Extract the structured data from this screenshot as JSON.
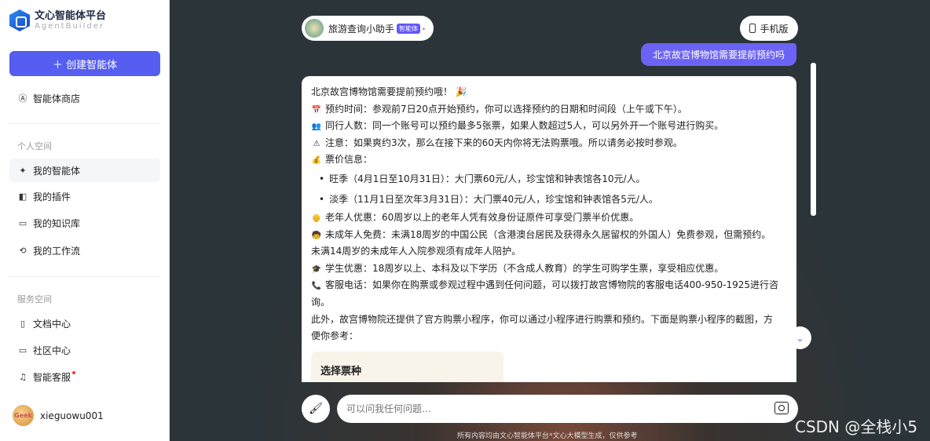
{
  "sidebar": {
    "logo_title": "文心智能体平台",
    "logo_sub": "AgentBuilder",
    "create_label": "创建智能体",
    "store": "智能体商店",
    "personal_title": "个人空间",
    "personal": [
      "我的智能体",
      "我的插件",
      "我的知识库",
      "我的工作流"
    ],
    "service_title": "服务空间",
    "service": [
      "文档中心",
      "社区中心",
      "智能客服"
    ],
    "username": "xieguowu001",
    "avatar_text": "Geek"
  },
  "header": {
    "agent_name": "旅游查询小助手",
    "agent_badge": "智能体",
    "mobile_label": "手机版"
  },
  "chat": {
    "user_message": "北京故宫博物馆需要提前预约吗",
    "answer": {
      "intro": "北京故宫博物馆需要提前预约哦！",
      "lines1": [
        {
          "icon": "calendar",
          "text": "预约时间：参观前7日20点开始预约，你可以选择预约的日期和时间段（上午或下午）。"
        },
        {
          "icon": "people",
          "text": "同行人数：同一个账号可以预约最多5张票，如果人数超过5人，可以另外开一个账号进行购买。"
        },
        {
          "icon": "warning",
          "text": "注意：如果爽约3次，那么在接下来的60天内你将无法购票哦。所以请务必按时参观。"
        },
        {
          "icon": "money-bag",
          "text": "票价信息："
        }
      ],
      "bullets": [
        "旺季（4月1日至10月31日）：大门票60元/人，珍宝馆和钟表馆各10元/人。",
        "淡季（11月1日至次年3月31日）：大门票40元/人，珍宝馆和钟表馆各5元/人。"
      ],
      "lines2": [
        {
          "icon": "elder",
          "text": "老年人优惠：60周岁以上的老年人凭有效身份证原件可享受门票半价优惠。"
        },
        {
          "icon": "child",
          "text": "未成年人免费：未满18周岁的中国公民（含港澳台居民及获得永久居留权的外国人）免费参观，但需预约。"
        },
        {
          "icon": "",
          "text": "未满14周岁的未成年人入院参观须有成年人陪护。"
        },
        {
          "icon": "grad-cap",
          "text": "学生优惠：18周岁以上、本科及以下学历（不含成人教育）的学生可购学生票，享受相应优惠。"
        },
        {
          "icon": "phone",
          "text": "客服电话：如果你在购票或参观过程中遇到任何问题，可以拨打故宫博物院的客服电话400-950-1925进行咨"
        },
        {
          "icon": "",
          "text": "询。"
        },
        {
          "icon": "",
          "text": "此外，故宫博物院还提供了官方购票小程序，你可以通过小程序进行购票和预约。下面是购票小程序的截图，方"
        },
        {
          "icon": "",
          "text": "便你参考："
        }
      ],
      "card_title": "选择票种"
    }
  },
  "input": {
    "placeholder": "可以问我任何问题…"
  },
  "footer": "所有内容均由文心智能体平台*文心大模型生成，仅供参考",
  "watermark": "CSDN @全栈小5",
  "colors": {
    "accent": "#555ef0",
    "user_bubble": "#6c63f6"
  }
}
